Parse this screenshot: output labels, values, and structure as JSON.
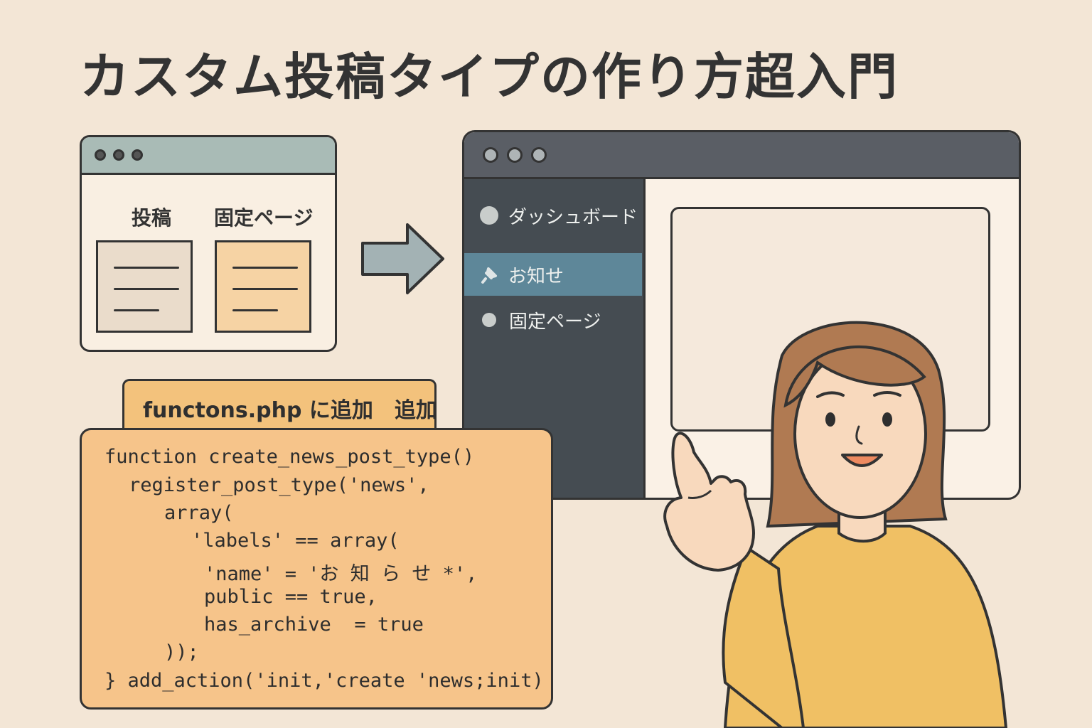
{
  "title": "カスタム投稿タイプの作り方超入門",
  "small_window": {
    "label_posts": "投稿",
    "label_pages": "固定ページ"
  },
  "admin_window": {
    "menu": [
      {
        "label": "ダッシュボード",
        "icon": "circle-icon"
      },
      {
        "label": "お知せ",
        "icon": "pin-icon",
        "active": true
      },
      {
        "label": "固定ページ",
        "icon": "circle-icon"
      }
    ]
  },
  "code_tab": {
    "label": "functons.php に追加　追加"
  },
  "code": [
    "function create_news_post_type()",
    "register_post_type('news',",
    "array(",
    "'labels' == array(",
    "'name' = 'お 知 ら せ *',",
    "public == true,",
    "has_archive  = true",
    "));",
    "} add_action('init,'create 'news;init)"
  ],
  "colors": {
    "background": "#f3e6d6",
    "active_menu": "#5e8799",
    "code_bg": "#f6c48a",
    "sidebar": "#454c52"
  }
}
